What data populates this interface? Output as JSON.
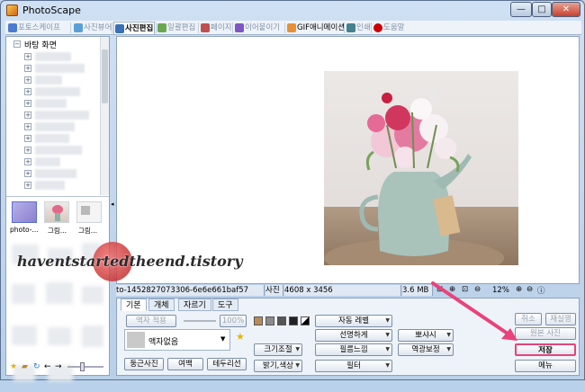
{
  "window": {
    "title": "PhotoScape",
    "min_label": "—",
    "max_label": "□",
    "close_label": "✕"
  },
  "tabs": [
    {
      "label": "포토스케이프",
      "color": "#4a7bd0"
    },
    {
      "label": "사진뷰어",
      "color": "#5aa0d8"
    },
    {
      "label": "사진편집",
      "color": "#3b6fb6",
      "active": true
    },
    {
      "label": "일괄편집",
      "color": "#6aa84f"
    },
    {
      "label": "페이지",
      "color": "#c0504d"
    },
    {
      "label": "이어붙이기",
      "color": "#7e57c2"
    },
    {
      "label": "GIF애니메이션",
      "color": "#e69138"
    },
    {
      "label": "인쇄",
      "color": "#45818e"
    },
    {
      "label": "도움말",
      "color": "#cc0000"
    }
  ],
  "tree": {
    "root_label": "바탕 화면"
  },
  "thumbnails": [
    {
      "label": "photo-..."
    },
    {
      "label": "그림..."
    },
    {
      "label": "그림..."
    }
  ],
  "watermark": "haventstartedtheend.tistory",
  "infobar": {
    "filename": "to-1452827073306-6e6e661baf57",
    "size_label": "사진",
    "dimensions": "4608 x 3456",
    "filesize": "3.6 MB",
    "zoom": "12%"
  },
  "edit_tabs": [
    "기본",
    "개체",
    "자르기",
    "도구"
  ],
  "edit": {
    "frame_apply": "액자 적용",
    "percent": "100%",
    "frame_none": "액자없음",
    "round": "둥근사진",
    "margin": "여백",
    "border": "테두리선",
    "auto_level": "자동 레벨",
    "resize": "크기조절",
    "brightness": "밝기,색상",
    "sharpen": "선명하게",
    "film": "필름느낌",
    "filter": "필터",
    "bloom": "뽀샤시",
    "backlight": "역광보정"
  },
  "right_buttons": {
    "cancel": "취소",
    "redo": "재실행",
    "original": "원본 사진",
    "save": "저장",
    "menu": "메뉴"
  },
  "colors": {
    "highlight": "#e8437a",
    "accent": "#3b6fb6"
  }
}
